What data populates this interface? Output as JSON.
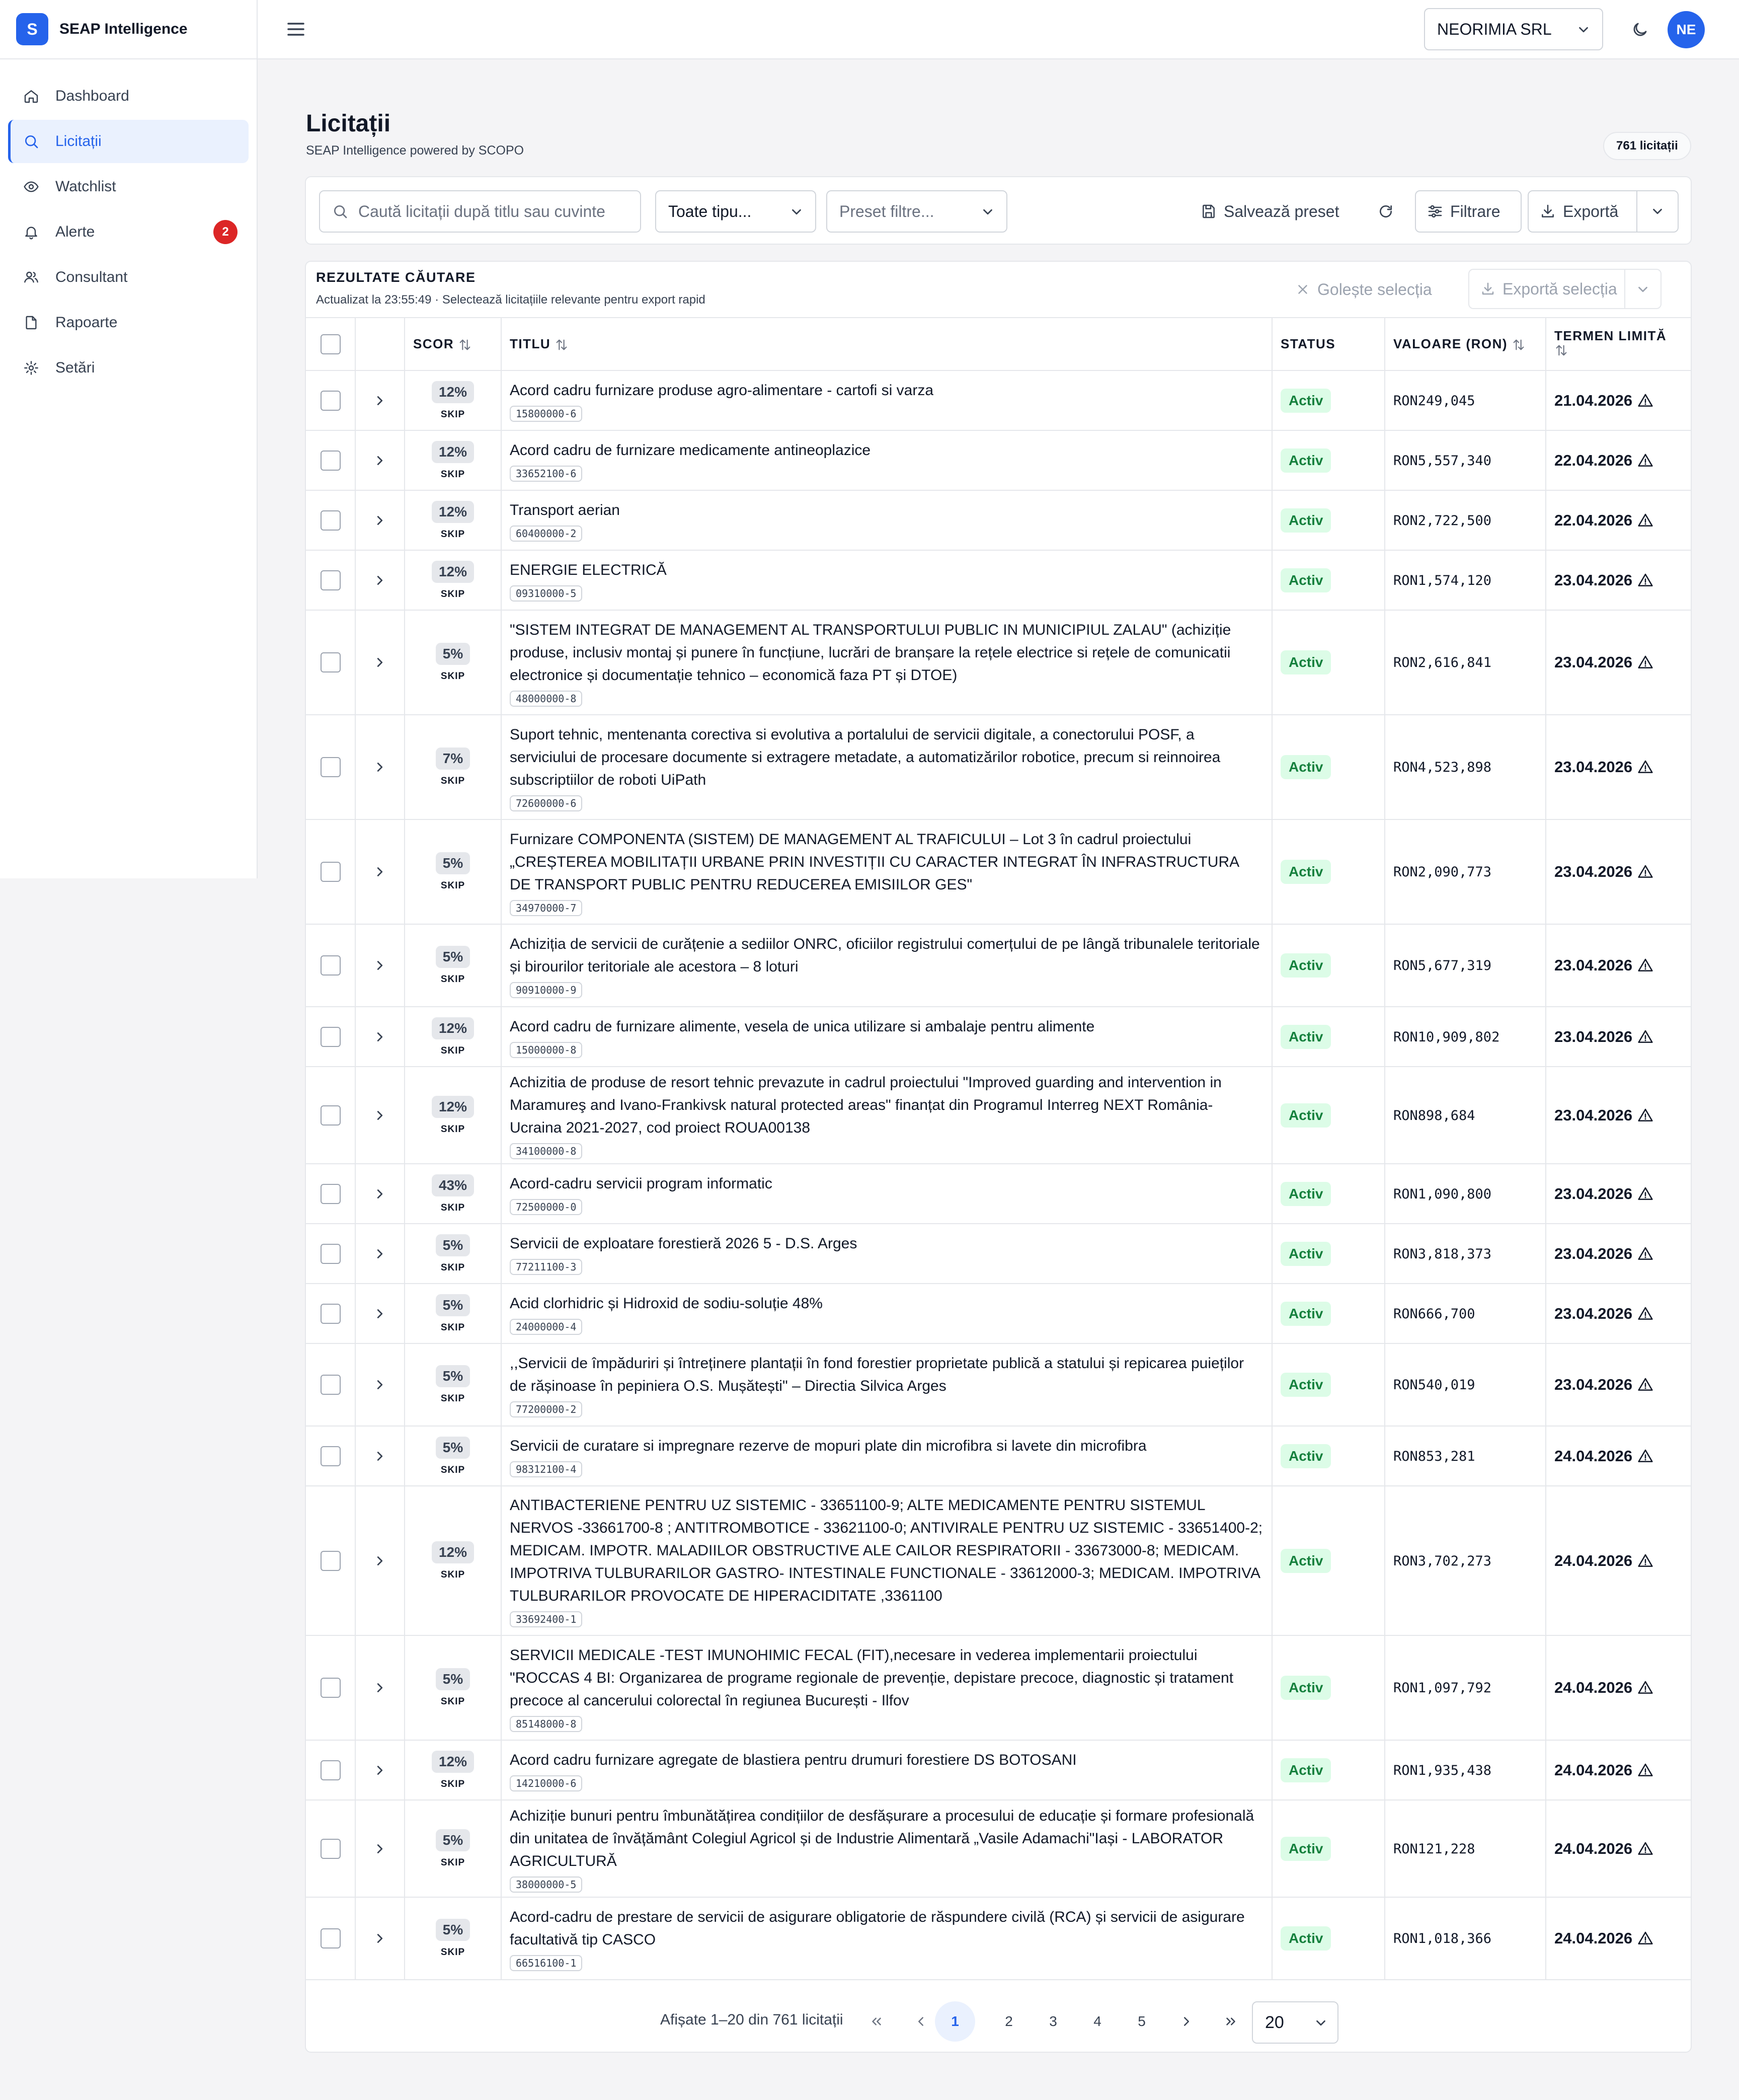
{
  "brand": {
    "logo_letter": "S",
    "name": "SEAP Intelligence"
  },
  "nav": [
    {
      "label": "Dashboard",
      "icon": "home-icon",
      "active": false
    },
    {
      "label": "Licitații",
      "icon": "search-icon",
      "active": true
    },
    {
      "label": "Watchlist",
      "icon": "eye-icon",
      "active": false
    },
    {
      "label": "Alerte",
      "icon": "bell-icon",
      "active": false,
      "badge": "2"
    },
    {
      "label": "Consultant",
      "icon": "users-icon",
      "active": false
    },
    {
      "label": "Rapoarte",
      "icon": "file-icon",
      "active": false
    },
    {
      "label": "Setări",
      "icon": "gear-icon",
      "active": false
    }
  ],
  "topbar": {
    "company": "NEORIMIA SRL",
    "avatar_initials": "NE"
  },
  "page": {
    "title": "Licitații",
    "subtitle": "SEAP Intelligence powered by SCOPO",
    "count_badge": "761 licitații"
  },
  "toolbar": {
    "search_placeholder": "Caută licitații după titlu sau cuvinte",
    "type_select": "Toate tipu...",
    "preset_select": "Preset filtre...",
    "save_preset": "Salvează preset",
    "filter": "Filtrare",
    "export": "Exportă"
  },
  "results": {
    "title": "REZULTATE CĂUTARE",
    "subtitle": "Actualizat la 23:55:49 · Selectează licitațiile relevante pentru export rapid",
    "clear_selection": "Golește selecția",
    "export_selection": "Exportă selecția"
  },
  "table": {
    "headers": {
      "score": "SCOR",
      "title": "TITLU",
      "status": "STATUS",
      "value": "VALOARE (RON)",
      "deadline": "TERMEN LIMITĂ"
    },
    "rows": [
      {
        "score": "12%",
        "skip": "SKIP",
        "title": "Acord cadru furnizare produse agro-alimentare - cartofi si varza",
        "cpv": "15800000-6",
        "status": "Activ",
        "value": "RON249,045",
        "deadline": "21.04.2026"
      },
      {
        "score": "12%",
        "skip": "SKIP",
        "title": "Acord cadru de furnizare medicamente antineoplazice",
        "cpv": "33652100-6",
        "status": "Activ",
        "value": "RON5,557,340",
        "deadline": "22.04.2026"
      },
      {
        "score": "12%",
        "skip": "SKIP",
        "title": "Transport aerian",
        "cpv": "60400000-2",
        "status": "Activ",
        "value": "RON2,722,500",
        "deadline": "22.04.2026"
      },
      {
        "score": "12%",
        "skip": "SKIP",
        "title": "ENERGIE ELECTRICĂ",
        "cpv": "09310000-5",
        "status": "Activ",
        "value": "RON1,574,120",
        "deadline": "23.04.2026"
      },
      {
        "score": "5%",
        "skip": "SKIP",
        "title": "\"SISTEM INTEGRAT DE MANAGEMENT AL TRANSPORTULUI PUBLIC IN MUNICIPIUL ZALAU\" (achiziție produse, inclusiv montaj și punere în funcțiune, lucrări de branșare la rețele electrice si rețele de comunicatii electronice și documentație tehnico – economică faza PT și DTOE)",
        "cpv": "48000000-8",
        "status": "Activ",
        "value": "RON2,616,841",
        "deadline": "23.04.2026"
      },
      {
        "score": "7%",
        "skip": "SKIP",
        "title": "Suport tehnic, mentenanta corectiva si evolutiva a portalului de servicii digitale, a conectorului POSF, a serviciului de procesare documente si extragere metadate, a automatizărilor robotice, precum si reinnoirea subscriptiilor de roboti UiPath",
        "cpv": "72600000-6",
        "status": "Activ",
        "value": "RON4,523,898",
        "deadline": "23.04.2026"
      },
      {
        "score": "5%",
        "skip": "SKIP",
        "title": "Furnizare COMPONENTA (SISTEM) DE MANAGEMENT AL TRAFICULUI – Lot 3 în cadrul proiectului „CREȘTEREA MOBILITAȚII URBANE PRIN INVESTIȚII CU CARACTER INTEGRAT ÎN INFRASTRUCTURA DE TRANSPORT PUBLIC PENTRU REDUCEREA EMISIILOR GES\"",
        "cpv": "34970000-7",
        "status": "Activ",
        "value": "RON2,090,773",
        "deadline": "23.04.2026"
      },
      {
        "score": "5%",
        "skip": "SKIP",
        "title": "Achiziția de servicii de curățenie a sediilor ONRC, oficiilor registrului comerțului de pe lângă tribunalele teritoriale și birourilor teritoriale ale acestora – 8 loturi",
        "cpv": "90910000-9",
        "status": "Activ",
        "value": "RON5,677,319",
        "deadline": "23.04.2026"
      },
      {
        "score": "12%",
        "skip": "SKIP",
        "title": "Acord cadru de furnizare alimente, vesela de unica utilizare si ambalaje pentru alimente",
        "cpv": "15000000-8",
        "status": "Activ",
        "value": "RON10,909,802",
        "deadline": "23.04.2026"
      },
      {
        "score": "12%",
        "skip": "SKIP",
        "title": "Achizitia de produse de resort tehnic prevazute in cadrul proiectului \"Improved guarding and intervention in Maramureş and Ivano-Frankivsk natural protected areas\" finanțat din Programul Interreg NEXT România-Ucraina 2021-2027, cod proiect ROUA00138",
        "cpv": "34100000-8",
        "status": "Activ",
        "value": "RON898,684",
        "deadline": "23.04.2026"
      },
      {
        "score": "43%",
        "skip": "SKIP",
        "title": "Acord-cadru servicii program informatic",
        "cpv": "72500000-0",
        "status": "Activ",
        "value": "RON1,090,800",
        "deadline": "23.04.2026"
      },
      {
        "score": "5%",
        "skip": "SKIP",
        "title": "Servicii de exploatare forestieră 2026 5 - D.S. Arges",
        "cpv": "77211100-3",
        "status": "Activ",
        "value": "RON3,818,373",
        "deadline": "23.04.2026"
      },
      {
        "score": "5%",
        "skip": "SKIP",
        "title": "Acid clorhidric și Hidroxid de sodiu-soluție 48%",
        "cpv": "24000000-4",
        "status": "Activ",
        "value": "RON666,700",
        "deadline": "23.04.2026"
      },
      {
        "score": "5%",
        "skip": "SKIP",
        "title": ",,Servicii de împăduriri și întreținere plantații în fond forestier proprietate publică a statului și repicarea puieților de rășinoase în pepiniera O.S. Mușătești\" – Directia Silvica Arges",
        "cpv": "77200000-2",
        "status": "Activ",
        "value": "RON540,019",
        "deadline": "23.04.2026"
      },
      {
        "score": "5%",
        "skip": "SKIP",
        "title": "Servicii de curatare si impregnare rezerve de mopuri plate din microfibra si lavete din microfibra",
        "cpv": "98312100-4",
        "status": "Activ",
        "value": "RON853,281",
        "deadline": "24.04.2026"
      },
      {
        "score": "12%",
        "skip": "SKIP",
        "title": "ANTIBACTERIENE PENTRU UZ SISTEMIC - 33651100-9; ALTE MEDICAMENTE PENTRU SISTEMUL NERVOS -33661700-8 ; ANTITROMBOTICE - 33621100-0; ANTIVIRALE PENTRU UZ SISTEMIC - 33651400-2; MEDICAM. IMPOTR. MALADIILOR OBSTRUCTIVE ALE CAILOR RESPIRATORII - 33673000-8; MEDICAM. IMPOTRIVA TULBURARILOR GASTRO- INTESTINALE FUNCTIONALE - 33612000-3; MEDICAM. IMPOTRIVA TULBURARILOR PROVOCATE DE HIPERACIDITATE ,3361100",
        "cpv": "33692400-1",
        "status": "Activ",
        "value": "RON3,702,273",
        "deadline": "24.04.2026"
      },
      {
        "score": "5%",
        "skip": "SKIP",
        "title": "SERVICII MEDICALE -TEST IMUNOHIMIC FECAL (FIT),necesare in vederea implementarii proiectului \"ROCCAS 4 BI: Organizarea de programe regionale de prevenție, depistare precoce, diagnostic și tratament precoce al cancerului colorectal în regiunea București - Ilfov",
        "cpv": "85148000-8",
        "status": "Activ",
        "value": "RON1,097,792",
        "deadline": "24.04.2026"
      },
      {
        "score": "12%",
        "skip": "SKIP",
        "title": "Acord cadru furnizare agregate de blastiera pentru drumuri forestiere DS BOTOSANI",
        "cpv": "14210000-6",
        "status": "Activ",
        "value": "RON1,935,438",
        "deadline": "24.04.2026"
      },
      {
        "score": "5%",
        "skip": "SKIP",
        "title": "Achiziție bunuri pentru îmbunătățirea condițiilor de desfășurare a procesului de educație și formare profesională din unitatea de învățământ Colegiul Agricol și de Industrie Alimentară „Vasile Adamachi\"Iași - LABORATOR AGRICULTURĂ",
        "cpv": "38000000-5",
        "status": "Activ",
        "value": "RON121,228",
        "deadline": "24.04.2026"
      },
      {
        "score": "5%",
        "skip": "SKIP",
        "title": "Acord-cadru de prestare de servicii de asigurare obligatorie de răspundere civilă (RCA) și servicii de asigurare facultativă tip CASCO",
        "cpv": "66516100-1",
        "status": "Activ",
        "value": "RON1,018,366",
        "deadline": "24.04.2026"
      }
    ]
  },
  "pagination": {
    "info": "Afișate 1–20 din 761 licitații",
    "pages": [
      "1",
      "2",
      "3",
      "4",
      "5"
    ],
    "current": "1",
    "page_size": "20"
  }
}
